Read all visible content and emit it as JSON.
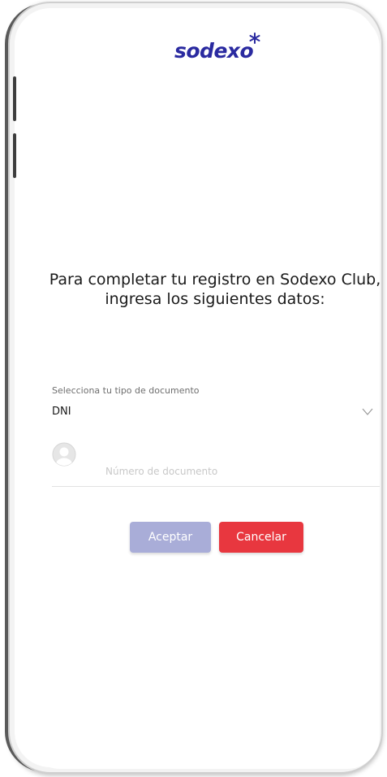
{
  "header": {
    "logo_text": "sodexo"
  },
  "intro": {
    "text": "Para completar tu registro en Sodexo Club, ingresa los siguientes datos:"
  },
  "form": {
    "document_type_label": "Selecciona tu tipo de documento",
    "document_type_value": "DNI",
    "document_number_placeholder": "Número de documento",
    "document_number_value": ""
  },
  "actions": {
    "accept_label": "Aceptar",
    "cancel_label": "Cancelar"
  },
  "colors": {
    "brand_blue": "#2a2aa0",
    "brand_red": "#e8373f",
    "accept_disabled": "#a9add8"
  },
  "icons": {
    "logo_star": "star-icon",
    "dropdown": "chevron-down-icon",
    "user": "user-icon"
  }
}
